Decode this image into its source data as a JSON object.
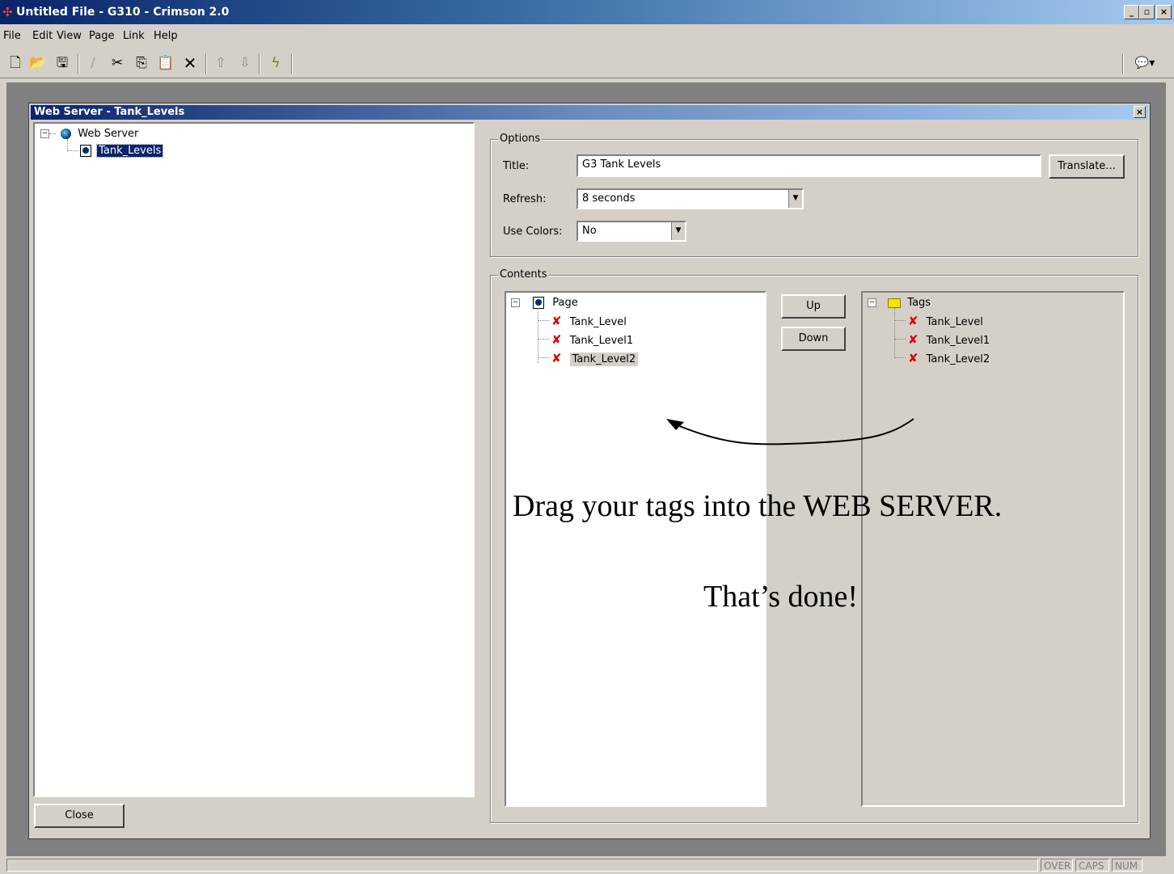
{
  "window": {
    "title": "Untitled File - G310 - Crimson 2.0"
  },
  "menu": {
    "items": [
      "File",
      "Edit",
      "View",
      "Page",
      "Link",
      "Help"
    ]
  },
  "toolbar": {
    "buttons": [
      "new-file-icon",
      "open-folder-icon",
      "save-icon",
      "pencil-icon",
      "cut-icon",
      "copy-icon",
      "paste-icon",
      "delete-icon",
      "move-up-icon",
      "move-down-icon",
      "lightning-icon",
      "chat-bubble-icon"
    ]
  },
  "child": {
    "title": "Web Server - Tank_Levels",
    "close_glyph": "×"
  },
  "tree": {
    "root": "Web Server",
    "child": "Tank_Levels"
  },
  "close_button": "Close",
  "options": {
    "legend": "Options",
    "title_label": "Title:",
    "title_value": "G3 Tank Levels",
    "translate_button": "Translate...",
    "refresh_label": "Refresh:",
    "refresh_value": "8 seconds",
    "colors_label": "Use Colors:",
    "colors_value": "No"
  },
  "contents": {
    "legend": "Contents",
    "page_root": "Page",
    "page_items": [
      "Tank_Level",
      "Tank_Level1",
      "Tank_Level2"
    ],
    "up_button": "Up",
    "down_button": "Down",
    "tags_root": "Tags",
    "tag_items": [
      "Tank_Level",
      "Tank_Level1",
      "Tank_Level2"
    ]
  },
  "annotation": {
    "line1": "Drag your tags into the WEB SERVER.",
    "line2": "That’s done!"
  },
  "status": {
    "panes": [
      "OVER",
      "CAPS",
      "NUM"
    ]
  },
  "colors": {
    "titlebar": "#0a246a",
    "error_x": "#e00000",
    "face": "#d4d0c8"
  }
}
